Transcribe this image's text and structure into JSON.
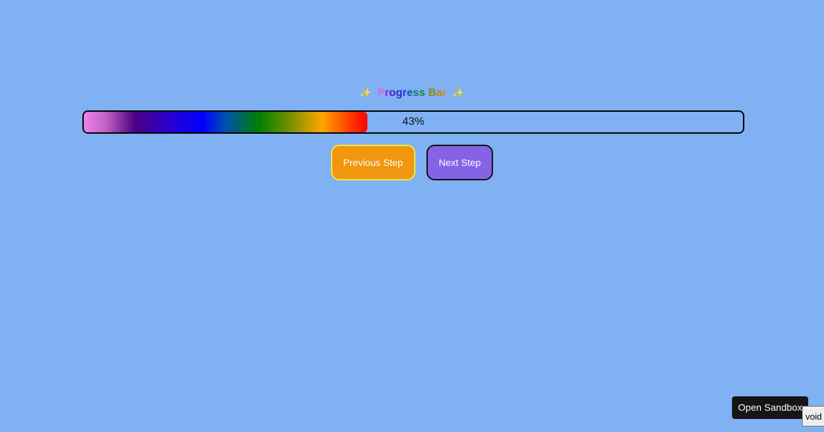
{
  "title": {
    "sparkle_left": "✨",
    "text": "Progress Bar",
    "sparkle_right": "✨"
  },
  "progress": {
    "value": 0.43,
    "label": "43%"
  },
  "buttons": {
    "previous_label": "Previous Step",
    "next_label": "Next Step"
  },
  "sandbox": {
    "open_label": "Open Sandbox",
    "void_label": "void"
  },
  "colors": {
    "background": "#7fb1f3",
    "previous_button": "#f0960f",
    "previous_border": "#f5e83a",
    "next_button": "#8663e6",
    "sandbox_button": "#151515"
  },
  "icons": {
    "sparkle": "sparkle-icon"
  }
}
